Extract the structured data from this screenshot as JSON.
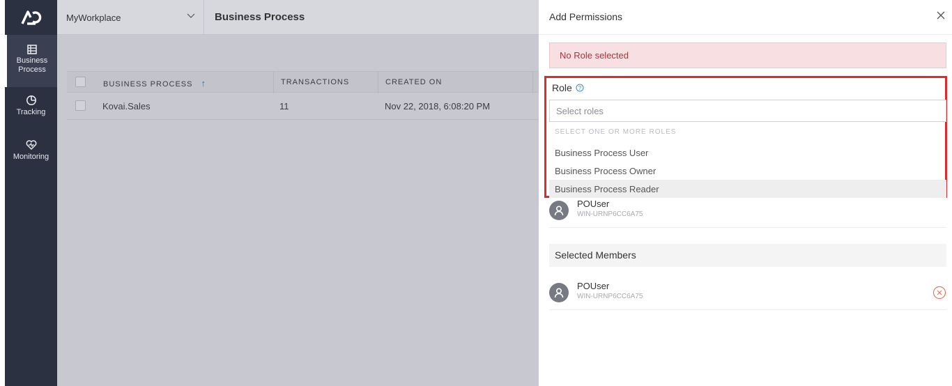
{
  "workspace": {
    "name": "MyWorkplace"
  },
  "header": {
    "title": "Business Process"
  },
  "nav": {
    "items": [
      {
        "label_line1": "Business",
        "label_line2": "Process",
        "icon": "business-process-icon"
      },
      {
        "label": "Tracking",
        "icon": "tracking-icon"
      },
      {
        "label": "Monitoring",
        "icon": "monitoring-icon"
      }
    ]
  },
  "table": {
    "columns": [
      "BUSINESS PROCESS",
      "TRANSACTIONS",
      "CREATED ON"
    ],
    "rows": [
      {
        "name": "Kovai.Sales",
        "transactions": "11",
        "created_on": "Nov 22, 2018, 6:08:20 PM"
      }
    ]
  },
  "panel": {
    "title": "Add Permissions",
    "alert": "No Role selected",
    "role": {
      "label": "Role",
      "placeholder": "Select roles",
      "dropdown_heading": "SELECT ONE OR MORE ROLES",
      "options": [
        "Business Process User",
        "Business Process Owner",
        "Business Process Reader"
      ]
    },
    "search_result": {
      "name": "POUser",
      "host": "WIN-URNP6CC6A75"
    },
    "selected_heading": "Selected Members",
    "selected": [
      {
        "name": "POUser",
        "host": "WIN-URNP6CC6A75"
      }
    ]
  },
  "colors": {
    "highlight": "#e02a2a",
    "alert_bg": "#f8dfe1",
    "rail": "#2c3142"
  }
}
